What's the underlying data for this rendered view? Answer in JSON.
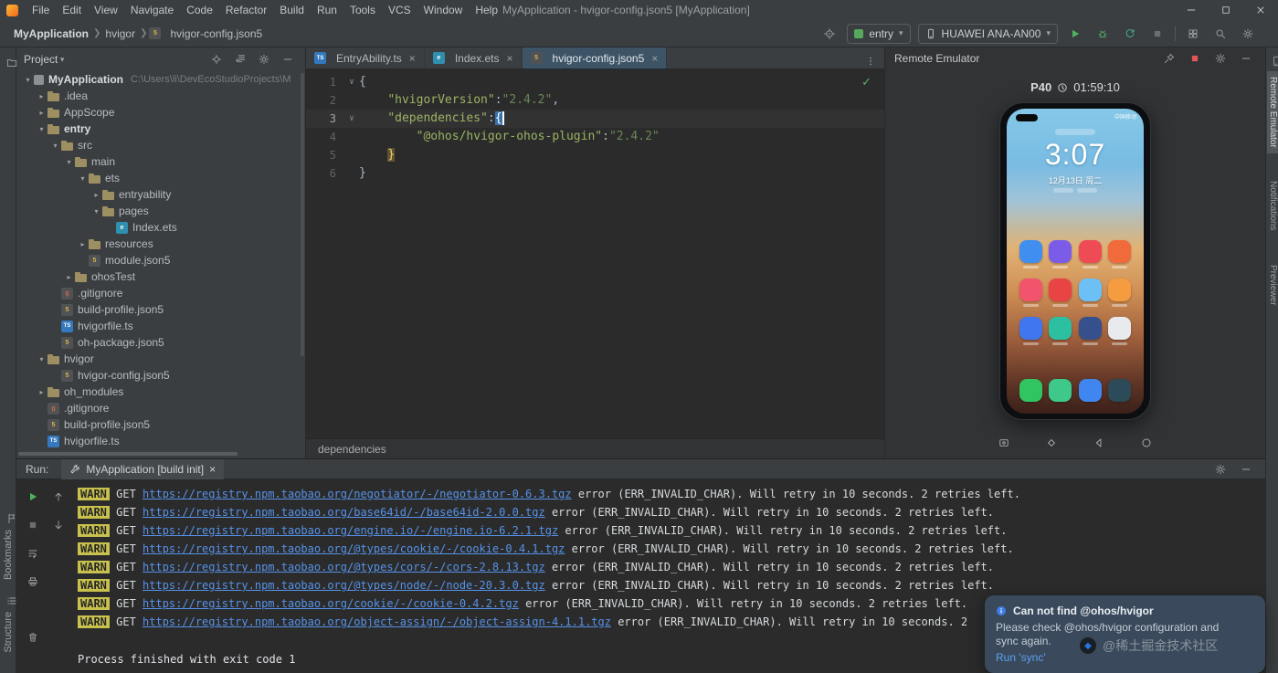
{
  "window": {
    "title": "MyApplication - hvigor-config.json5 [MyApplication]",
    "controls": [
      "minimize",
      "maximize",
      "close"
    ]
  },
  "menu": [
    "File",
    "Edit",
    "View",
    "Navigate",
    "Code",
    "Refactor",
    "Build",
    "Run",
    "Tools",
    "VCS",
    "Window",
    "Help"
  ],
  "toolbar": {
    "breadcrumbs": [
      "MyApplication",
      "hvigor",
      "hvigor-config.json5"
    ],
    "left_icon": "target",
    "run_config": "entry",
    "device": "HUAWEI ANA-AN00",
    "action_icons": [
      "run",
      "debug",
      "sync",
      "stop"
    ],
    "right_icons": [
      "device-manager",
      "search",
      "settings"
    ]
  },
  "left_strip": {
    "top_icon": "project-folder",
    "bottom_items": [
      {
        "label": "Bookmarks",
        "icon": "bookmarks"
      },
      {
        "label": "Structure",
        "icon": "structure"
      }
    ]
  },
  "right_strip": {
    "top_icon": "device",
    "labels": [
      {
        "text": "Remote Emulator",
        "selected": true
      },
      {
        "text": "Notifications",
        "selected": false
      },
      {
        "text": "Previewer",
        "selected": false
      }
    ]
  },
  "project_panel": {
    "title": "Project",
    "header_icons": [
      "locate",
      "collapse-all",
      "settings",
      "hide"
    ],
    "tree": [
      {
        "label": "MyApplication",
        "suffix": "C:\\Users\\li\\DevEcoStudioProjects\\M",
        "depth": 0,
        "chevron": "down",
        "icon": "project",
        "bold": true
      },
      {
        "label": ".idea",
        "depth": 1,
        "chevron": "right",
        "icon": "folder"
      },
      {
        "label": "AppScope",
        "depth": 1,
        "chevron": "right",
        "icon": "folder"
      },
      {
        "label": "entry",
        "depth": 1,
        "chevron": "down",
        "icon": "module",
        "bold": true
      },
      {
        "label": "src",
        "depth": 2,
        "chevron": "down",
        "icon": "folder"
      },
      {
        "label": "main",
        "depth": 3,
        "chevron": "down",
        "icon": "folder"
      },
      {
        "label": "ets",
        "depth": 4,
        "chevron": "down",
        "icon": "folder"
      },
      {
        "label": "entryability",
        "depth": 5,
        "chevron": "right",
        "icon": "folder"
      },
      {
        "label": "pages",
        "depth": 5,
        "chevron": "down",
        "icon": "folder"
      },
      {
        "label": "Index.ets",
        "depth": 6,
        "chevron": "none",
        "icon": "ets"
      },
      {
        "label": "resources",
        "depth": 4,
        "chevron": "right",
        "icon": "folder"
      },
      {
        "label": "module.json5",
        "depth": 4,
        "chevron": "none",
        "icon": "json"
      },
      {
        "label": "ohosTest",
        "depth": 3,
        "chevron": "right",
        "icon": "folder"
      },
      {
        "label": ".gitignore",
        "depth": 2,
        "chevron": "none",
        "icon": "git"
      },
      {
        "label": "build-profile.json5",
        "depth": 2,
        "chevron": "none",
        "icon": "json"
      },
      {
        "label": "hvigorfile.ts",
        "depth": 2,
        "chevron": "none",
        "icon": "ts"
      },
      {
        "label": "oh-package.json5",
        "depth": 2,
        "chevron": "none",
        "icon": "json"
      },
      {
        "label": "hvigor",
        "depth": 1,
        "chevron": "down",
        "icon": "folder"
      },
      {
        "label": "hvigor-config.json5",
        "depth": 2,
        "chevron": "none",
        "icon": "json"
      },
      {
        "label": "oh_modules",
        "depth": 1,
        "chevron": "right",
        "icon": "folder"
      },
      {
        "label": ".gitignore",
        "depth": 1,
        "chevron": "none",
        "icon": "git"
      },
      {
        "label": "build-profile.json5",
        "depth": 1,
        "chevron": "none",
        "icon": "json"
      },
      {
        "label": "hvigorfile.ts",
        "depth": 1,
        "chevron": "none",
        "icon": "ts"
      }
    ]
  },
  "editor": {
    "tabs": [
      {
        "label": "EntryAbility.ts",
        "icon": "ts",
        "active": false
      },
      {
        "label": "Index.ets",
        "icon": "ets",
        "active": false
      },
      {
        "label": "hvigor-config.json5",
        "icon": "json",
        "active": true
      }
    ],
    "status_icon": "check",
    "breadcrumb": "dependencies",
    "lines": [
      {
        "n": 1,
        "fold": true,
        "tokens": [
          [
            "{",
            "br"
          ]
        ]
      },
      {
        "n": 2,
        "tokens": [
          [
            "    ",
            "pl"
          ],
          [
            "\"hvigorVersion\"",
            "key"
          ],
          [
            ":",
            "pl"
          ],
          [
            "\"2.4.2\"",
            "str"
          ],
          [
            ",",
            "pl"
          ]
        ]
      },
      {
        "n": 3,
        "fold": true,
        "current": true,
        "caret": true,
        "tokens": [
          [
            "    ",
            "pl"
          ],
          [
            "\"dependencies\"",
            "key"
          ],
          [
            ":",
            "pl"
          ],
          [
            "{",
            "cur"
          ]
        ]
      },
      {
        "n": 4,
        "tokens": [
          [
            "        ",
            "pl"
          ],
          [
            "\"@ohos/hvigor-ohos-plugin\"",
            "key"
          ],
          [
            ":",
            "pl"
          ],
          [
            "\"2.4.2\"",
            "str"
          ]
        ]
      },
      {
        "n": 5,
        "tokens": [
          [
            "    ",
            "pl"
          ],
          [
            "}",
            "match"
          ]
        ]
      },
      {
        "n": 6,
        "tokens": [
          [
            "}",
            "br"
          ]
        ]
      }
    ]
  },
  "emulator": {
    "title": "Remote Emulator",
    "header_icons": [
      "pin",
      "stop",
      "settings",
      "hide"
    ],
    "device": "P40",
    "uptime": "01:59:10",
    "tools": [
      "screenshot",
      "rotate",
      "back",
      "home"
    ],
    "phone": {
      "carrier": "中国移动",
      "time": "3:07",
      "date": "12月13日 周二",
      "grid_colors": [
        "#3f8ef0",
        "#7a5ce8",
        "#ef4b55",
        "#f06a3c",
        "#f2546e",
        "#e84444",
        "#6cc0f5",
        "#f59b40",
        "#4076f0",
        "#2cbfa0",
        "#35508c",
        "#e8eaee"
      ],
      "dock_colors": [
        "#30c560",
        "#3ec98a",
        "#3f86f0",
        "#2c4a58"
      ]
    }
  },
  "run_panel": {
    "label": "Run:",
    "tab": "MyApplication [build init]",
    "header_icons": [
      "settings",
      "hide"
    ],
    "toolbar_col1": [
      "rerun",
      "stop",
      "softwrap",
      "print",
      "clear"
    ],
    "toolbar_col2": [
      "scroll-up",
      "scroll-down"
    ],
    "console": {
      "warn_label": "WARN",
      "method": "GET",
      "lines": [
        {
          "url": "https://registry.npm.taobao.org/negotiator/-/negotiator-0.6.3.tgz",
          "tail": "error (ERR_INVALID_CHAR). Will retry in 10 seconds. 2 retries left."
        },
        {
          "url": "https://registry.npm.taobao.org/base64id/-/base64id-2.0.0.tgz",
          "tail": "error (ERR_INVALID_CHAR). Will retry in 10 seconds. 2 retries left."
        },
        {
          "url": "https://registry.npm.taobao.org/engine.io/-/engine.io-6.2.1.tgz",
          "tail": "error (ERR_INVALID_CHAR). Will retry in 10 seconds. 2 retries left."
        },
        {
          "url": "https://registry.npm.taobao.org/@types/cookie/-/cookie-0.4.1.tgz",
          "tail": "error (ERR_INVALID_CHAR). Will retry in 10 seconds. 2 retries left."
        },
        {
          "url": "https://registry.npm.taobao.org/@types/cors/-/cors-2.8.13.tgz",
          "tail": "error (ERR_INVALID_CHAR). Will retry in 10 seconds. 2 retries left."
        },
        {
          "url": "https://registry.npm.taobao.org/@types/node/-/node-20.3.0.tgz",
          "tail": "error (ERR_INVALID_CHAR). Will retry in 10 seconds. 2 retries left."
        },
        {
          "url": "https://registry.npm.taobao.org/cookie/-/cookie-0.4.2.tgz",
          "tail": "error (ERR_INVALID_CHAR). Will retry in 10 seconds. 2 retries left."
        },
        {
          "url": "https://registry.npm.taobao.org/object-assign/-/object-assign-4.1.1.tgz",
          "tail": "error (ERR_INVALID_CHAR). Will retry in 10 seconds. 2"
        }
      ],
      "process": "Process finished with exit code 1"
    }
  },
  "notification": {
    "icon": "info",
    "title": "Can not find @ohos/hvigor",
    "body": "Please check @ohos/hvigor configuration and sync again.",
    "action": "Run 'sync'"
  },
  "watermark": {
    "text": "@稀土掘金技术社区"
  },
  "colors": {
    "accent_green": "#4db35f",
    "warn_badge": "#c8c14d",
    "link_blue": "#5692e8",
    "string_green": "#6a8759",
    "active_tab": "#3d5466"
  }
}
